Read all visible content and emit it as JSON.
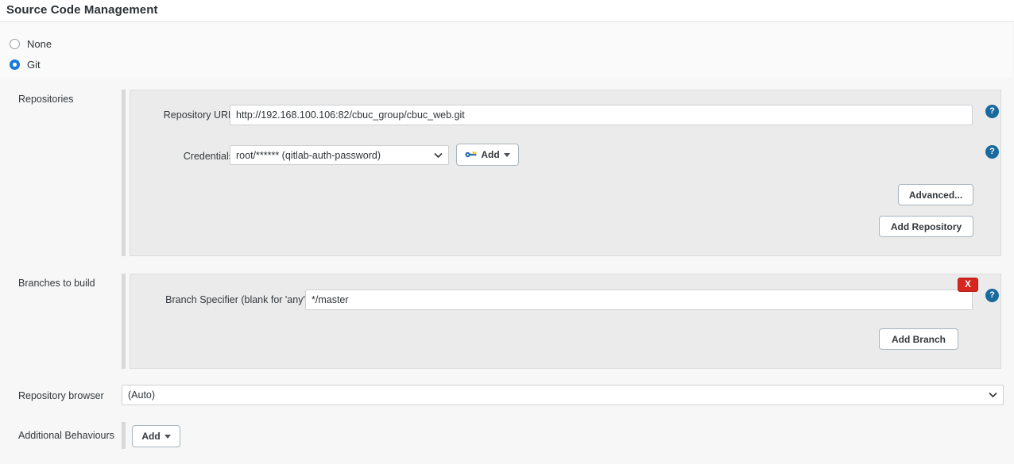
{
  "section": {
    "title": "Source Code Management"
  },
  "scm_choice": {
    "options": [
      {
        "label": "None",
        "selected": false
      },
      {
        "label": "Git",
        "selected": true
      }
    ]
  },
  "repositories": {
    "row_label": "Repositories",
    "repository_url": {
      "label": "Repository URL",
      "value": "http://192.168.100.106:82/cbuc_group/cbuc_web.git",
      "help": "?"
    },
    "credentials": {
      "label": "Credentials",
      "selected": "root/****** (qitlab-auth-password)",
      "add_button": "Add",
      "add_icon": "key-icon",
      "help": "?"
    },
    "advanced_button": "Advanced...",
    "add_repository_button": "Add Repository"
  },
  "branches": {
    "row_label": "Branches to build",
    "branch_specifier": {
      "label": "Branch Specifier (blank for 'any')",
      "value": "*/master",
      "delete_label": "X",
      "help": "?"
    },
    "add_branch_button": "Add Branch"
  },
  "repository_browser": {
    "row_label": "Repository browser",
    "selected": "(Auto)"
  },
  "additional_behaviours": {
    "row_label": "Additional Behaviours",
    "add_button": "Add"
  },
  "colors": {
    "accent_blue": "#1a7ada",
    "help_blue": "#18699e",
    "danger_red": "#d6261f",
    "panel_bg": "#ebebeb",
    "page_bg": "#f7f7f7"
  }
}
